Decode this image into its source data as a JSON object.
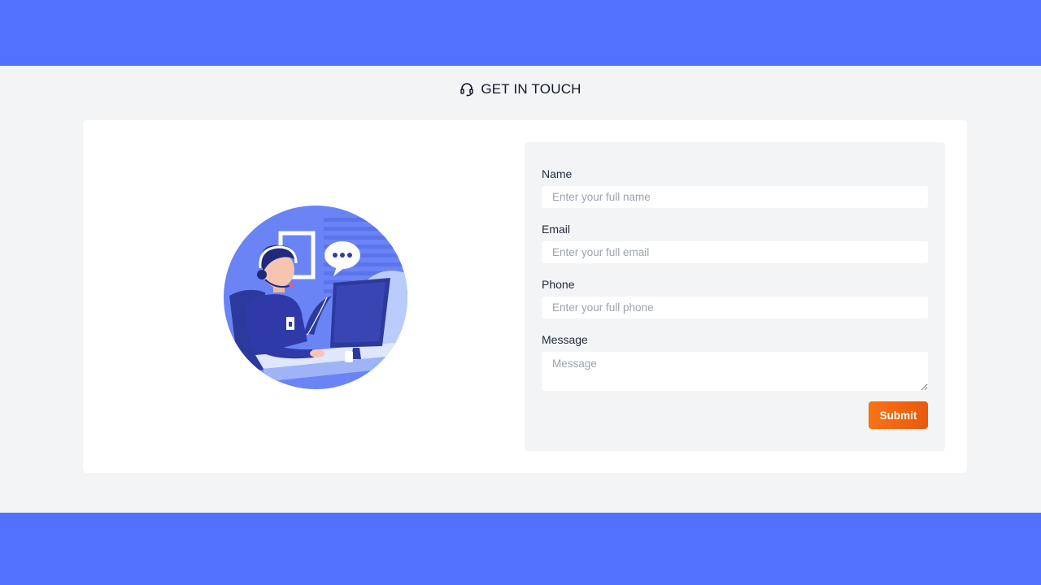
{
  "header": {
    "title": "GET IN TOUCH",
    "icon": "headset-icon"
  },
  "colors": {
    "brand": "#5271ff",
    "accent": "#f97316",
    "panel": "#f3f4f6"
  },
  "illustration": {
    "icon": "support-agent-illustration"
  },
  "form": {
    "name": {
      "label": "Name",
      "placeholder": "Enter your full name",
      "value": ""
    },
    "email": {
      "label": "Email",
      "placeholder": "Enter your full email",
      "value": ""
    },
    "phone": {
      "label": "Phone",
      "placeholder": "Enter your full phone",
      "value": ""
    },
    "message": {
      "label": "Message",
      "placeholder": "Message",
      "value": ""
    },
    "submit_label": "Submit"
  }
}
